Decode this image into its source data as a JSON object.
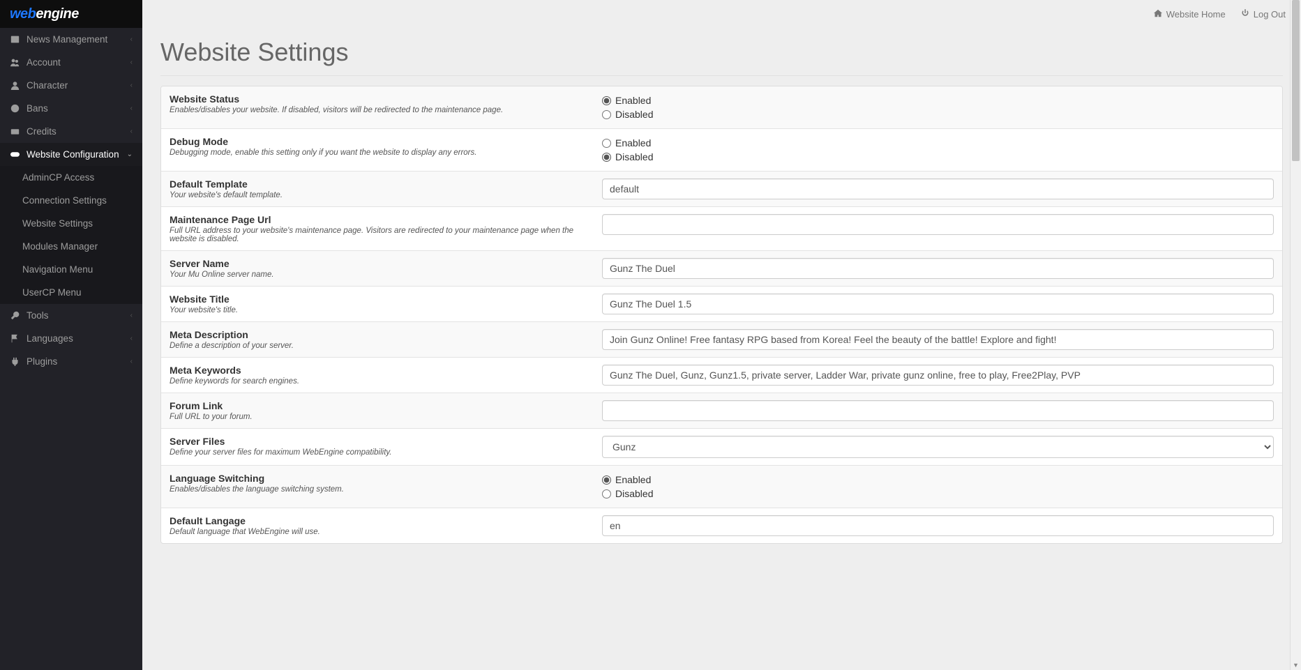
{
  "brand": {
    "web": "web",
    "engine": "engine"
  },
  "topbar": {
    "website_home": "Website Home",
    "log_out": "Log Out"
  },
  "page_title": "Website Settings",
  "sidebar": {
    "items": [
      {
        "label": "News Management",
        "icon": "newspaper"
      },
      {
        "label": "Account",
        "icon": "users"
      },
      {
        "label": "Character",
        "icon": "user"
      },
      {
        "label": "Bans",
        "icon": "info"
      },
      {
        "label": "Credits",
        "icon": "credit"
      },
      {
        "label": "Website Configuration",
        "icon": "toggle",
        "expanded": true,
        "children": [
          {
            "label": "AdminCP Access"
          },
          {
            "label": "Connection Settings"
          },
          {
            "label": "Website Settings"
          },
          {
            "label": "Modules Manager"
          },
          {
            "label": "Navigation Menu"
          },
          {
            "label": "UserCP Menu"
          }
        ]
      },
      {
        "label": "Tools",
        "icon": "wrench"
      },
      {
        "label": "Languages",
        "icon": "flag"
      },
      {
        "label": "Plugins",
        "icon": "plug"
      }
    ]
  },
  "radio": {
    "enabled": "Enabled",
    "disabled": "Disabled"
  },
  "settings": {
    "website_status": {
      "title": "Website Status",
      "desc": "Enables/disables your website. If disabled, visitors will be redirected to the maintenance page.",
      "value": "enabled"
    },
    "debug_mode": {
      "title": "Debug Mode",
      "desc": "Debugging mode, enable this setting only if you want the website to display any errors.",
      "value": "disabled"
    },
    "default_template": {
      "title": "Default Template",
      "desc": "Your website's default template.",
      "value": "default"
    },
    "maintenance_url": {
      "title": "Maintenance Page Url",
      "desc": "Full URL address to your website's maintenance page. Visitors are redirected to your maintenance page when the website is disabled.",
      "value": ""
    },
    "server_name": {
      "title": "Server Name",
      "desc": "Your Mu Online server name.",
      "value": "Gunz The Duel"
    },
    "website_title": {
      "title": "Website Title",
      "desc": "Your website's title.",
      "value": "Gunz The Duel 1.5"
    },
    "meta_description": {
      "title": "Meta Description",
      "desc": "Define a description of your server.",
      "value": "Join Gunz Online! Free fantasy RPG based from Korea! Feel the beauty of the battle! Explore and fight!"
    },
    "meta_keywords": {
      "title": "Meta Keywords",
      "desc": "Define keywords for search engines.",
      "value": "Gunz The Duel, Gunz, Gunz1.5, private server, Ladder War, private gunz online, free to play, Free2Play, PVP"
    },
    "forum_link": {
      "title": "Forum Link",
      "desc": "Full URL to your forum.",
      "value": ""
    },
    "server_files": {
      "title": "Server Files",
      "desc": "Define your server files for maximum WebEngine compatibility.",
      "value": "Gunz"
    },
    "language_switching": {
      "title": "Language Switching",
      "desc": "Enables/disables the language switching system.",
      "value": "enabled"
    },
    "default_language": {
      "title": "Default Langage",
      "desc": "Default language that WebEngine will use.",
      "value": "en"
    }
  }
}
